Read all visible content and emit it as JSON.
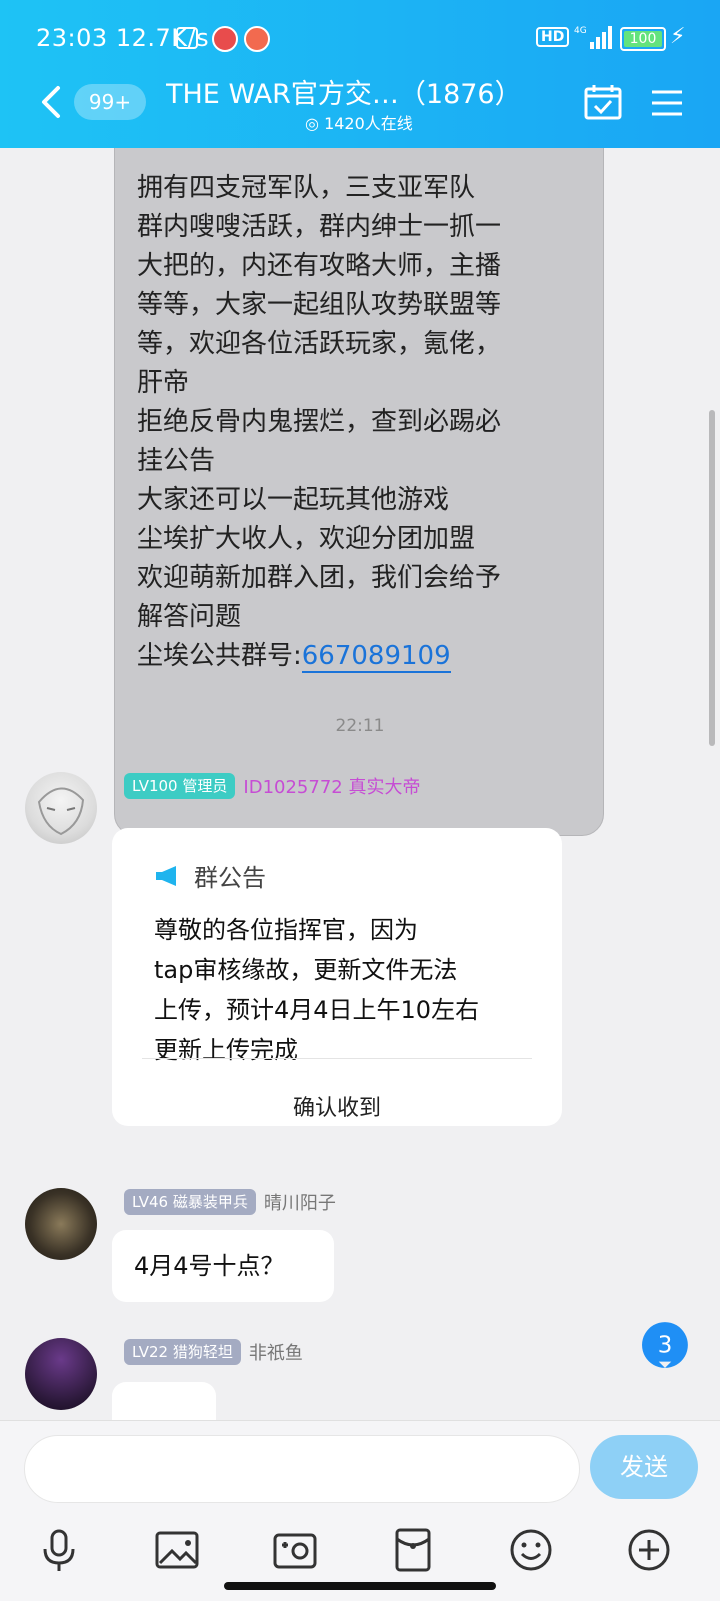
{
  "status": {
    "time": "23:03",
    "speed": "12.7K/s",
    "hd": "HD",
    "network": "4G",
    "battery": "100",
    "battery_level_pct": 100
  },
  "header": {
    "unread_badge": "99+",
    "title": "THE WAR官方交…（1876）",
    "online": "1420人在线"
  },
  "announcement_tail": {
    "lines": [
      "拥有四支冠军队，三支亚军队",
      "群内嗖嗖活跃，群内绅士一抓一",
      "大把的，内还有攻略大师，主播",
      "等等，大家一起组队攻势联盟等",
      "等，欢迎各位活跃玩家，氪佬，",
      "肝帝",
      "拒绝反骨内鬼摆烂，查到必踢必",
      "挂公告",
      "大家还可以一起玩其他游戏",
      "尘埃扩大收人，欢迎分团加盟",
      "欢迎萌新加群入团，我们会给予",
      "解答问题"
    ],
    "group_no_label": "尘埃公共群号:",
    "group_no": "667089109"
  },
  "timestamp": "22:11",
  "messages": [
    {
      "level": "LV100",
      "title": "管理员",
      "name": "ID1025772 真实大帝",
      "level_color": "#3dccc4",
      "name_color": "#c64dd4"
    },
    {
      "level": "LV46",
      "title": "磁暴装甲兵",
      "name": "晴川阳子",
      "level_color": "#a4abc2",
      "name_color": "#777777",
      "text": "4月4号十点？"
    },
    {
      "level": "LV22",
      "title": "猎狗轻坦",
      "name": "非祇鱼",
      "level_color": "#a4abc2",
      "name_color": "#777777"
    }
  ],
  "notice_card": {
    "header": "群公告",
    "lines": [
      "尊敬的各位指挥官，因为",
      "tap审核缘故，更新文件无法",
      "上传，预计4月4日上午10左右",
      "更新上传完成"
    ],
    "confirm": "确认收到"
  },
  "unread_count": "3",
  "input": {
    "send_label": "发送"
  },
  "toolbar": [
    "mic-icon",
    "image-icon",
    "camera-icon",
    "red-packet-icon",
    "emoji-icon",
    "plus-icon"
  ],
  "colors": {
    "accent": "#1aa6f4",
    "link": "#1a73d9"
  }
}
